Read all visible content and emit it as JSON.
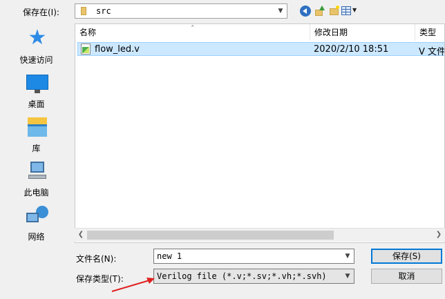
{
  "toolbar": {
    "lookin_label": "保存在(I):",
    "lookin_value": "src",
    "back_icon": "back-arrow-icon",
    "up_icon": "up-folder-icon",
    "new_folder_icon": "new-folder-icon",
    "view_icon": "view-menu-icon"
  },
  "sidebar": {
    "items": [
      {
        "label": "快速访问",
        "icon": "star-icon"
      },
      {
        "label": "桌面",
        "icon": "monitor-icon"
      },
      {
        "label": "库",
        "icon": "library-icon"
      },
      {
        "label": "此电脑",
        "icon": "pc-icon"
      },
      {
        "label": "网络",
        "icon": "network-icon"
      }
    ]
  },
  "file_list": {
    "columns": [
      "名称",
      "修改日期",
      "类型"
    ],
    "rows": [
      {
        "name": "flow_led.v",
        "date": "2020/2/10 18:51",
        "type": "V 文件"
      }
    ]
  },
  "bottom": {
    "filename_label": "文件名(N):",
    "filename_value": "new 1",
    "filetype_label": "保存类型(T):",
    "filetype_value": "Verilog file (*.v;*.sv;*.vh;*.svh)",
    "save_label": "保存(S)",
    "cancel_label": "取消"
  },
  "colors": {
    "accent": "#0078d7",
    "selection": "#cce8ff",
    "annotation": "#e02020"
  }
}
